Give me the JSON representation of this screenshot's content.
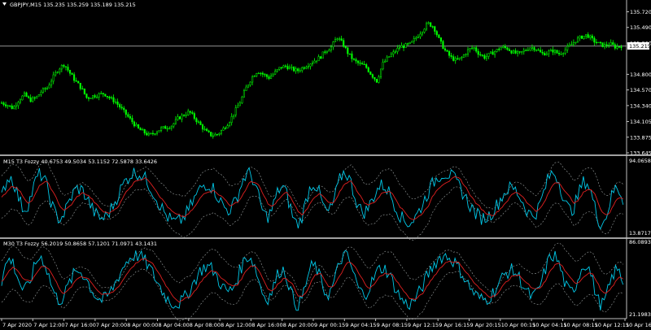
{
  "main": {
    "symbol": "GBPJPY,M15",
    "ohlc": "135.235 135.259 135.189 135.215",
    "header": "GBPJPY,M15  135.235 135.259 135.189 135.215",
    "price_tag": "135.215",
    "bid_line_color": "#c0c0c0",
    "candle_color": "#00ff00"
  },
  "indicator1": {
    "header": "M15 T3 Fozzy 40.6753 49.5034 53.1152 72.5878 33.6426",
    "line_color": "#00c8e8",
    "signal_color": "#e02020",
    "band_color": "#9aa0a0"
  },
  "indicator2": {
    "header": "M30 T3 Fozzy 56.2019 50.8658 57.1201 71.0971 43.1431",
    "line_color": "#00c8e8",
    "signal_color": "#e02020",
    "band_color": "#9aa0a0"
  },
  "chart_data": [
    {
      "type": "candlestick",
      "title": "GBPJPY,M15",
      "y_ticks": [
        "135.720",
        "135.490",
        "135.260",
        "134.800",
        "134.570",
        "134.340",
        "134.105",
        "133.875",
        "133.645"
      ],
      "ylim": [
        133.645,
        135.75
      ],
      "last_price": 135.215,
      "path_shape": [
        134.38,
        134.35,
        134.3,
        134.42,
        134.5,
        134.42,
        134.45,
        134.55,
        134.6,
        134.75,
        134.88,
        134.95,
        134.82,
        134.7,
        134.6,
        134.45,
        134.48,
        134.5,
        134.52,
        134.45,
        134.4,
        134.3,
        134.2,
        134.1,
        134.0,
        133.95,
        133.9,
        133.95,
        134.0,
        134.02,
        134.05,
        134.15,
        134.2,
        134.25,
        134.15,
        134.05,
        133.95,
        133.9,
        133.92,
        134.0,
        134.1,
        134.25,
        134.4,
        134.6,
        134.75,
        134.85,
        134.8,
        134.75,
        134.82,
        134.9,
        134.92,
        134.88,
        134.85,
        134.9,
        134.95,
        135.0,
        135.05,
        135.15,
        135.2,
        135.35,
        135.25,
        135.1,
        135.0,
        134.95,
        134.92,
        134.8,
        134.7,
        134.95,
        135.05,
        135.12,
        135.2,
        135.22,
        135.25,
        135.35,
        135.45,
        135.55,
        135.5,
        135.3,
        135.15,
        135.05,
        135.0,
        135.05,
        135.15,
        135.2,
        135.1,
        135.05,
        135.1,
        135.15,
        135.2,
        135.18,
        135.12,
        135.1,
        135.15,
        135.2,
        135.18,
        135.1,
        135.12,
        135.15,
        135.1,
        135.15,
        135.22,
        135.3,
        135.35,
        135.38,
        135.3,
        135.25,
        135.22,
        135.25,
        135.2,
        135.22
      ]
    },
    {
      "type": "line",
      "title": "M15 T3 Fozzy",
      "values_shown": [
        40.6753,
        49.5034,
        53.1152,
        72.5878,
        33.6426
      ],
      "y_ticks": [
        "94.0658",
        "13.8717"
      ],
      "ylim": [
        13.8717,
        94.0658
      ]
    },
    {
      "type": "line",
      "title": "M30 T3 Fozzy",
      "values_shown": [
        56.2019,
        50.8658,
        57.1201,
        71.0971,
        43.1431
      ],
      "y_ticks": [
        "86.0893",
        "21.1983"
      ],
      "ylim": [
        21.1983,
        86.0893
      ]
    }
  ],
  "x_labels": [
    "7 Apr 2020",
    "7 Apr 12:00",
    "7 Apr 16:00",
    "7 Apr 20:00",
    "8 Apr 00:00",
    "8 Apr 04:00",
    "8 Apr 08:00",
    "8 Apr 12:00",
    "8 Apr 16:00",
    "8 Apr 20:00",
    "9 Apr 00:15",
    "9 Apr 04:15",
    "9 Apr 08:15",
    "9 Apr 12:15",
    "9 Apr 16:15",
    "9 Apr 20:15",
    "10 Apr 00:15",
    "10 Apr 04:15",
    "10 Apr 08:15",
    "10 Apr 12:15",
    "10 Apr 16:15"
  ]
}
